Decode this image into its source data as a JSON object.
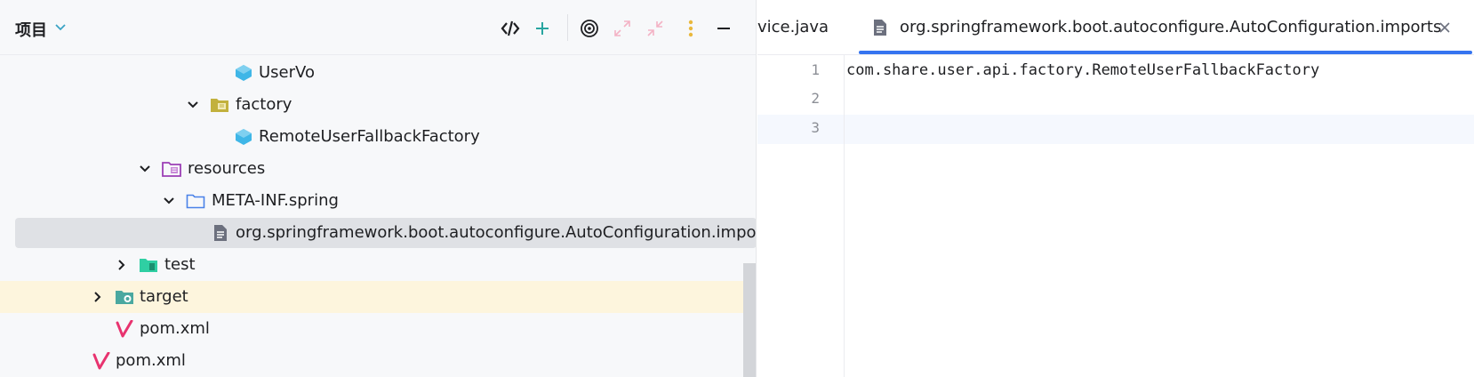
{
  "project_panel": {
    "title": "项目",
    "toolbar": {
      "navigate_icon": "code-link-icon",
      "add_icon": "plus-icon",
      "locate_icon": "target-icon",
      "expand_icon": "expand-all-icon",
      "collapse_icon": "collapse-all-icon",
      "options_icon": "kebab-menu-icon",
      "hide_icon": "minus-icon"
    },
    "tree": [
      {
        "label": "UserVo",
        "icon": "class-icon",
        "arrow": "none"
      },
      {
        "label": "factory",
        "icon": "package-folder-icon",
        "arrow": "expanded"
      },
      {
        "label": "RemoteUserFallbackFactory",
        "icon": "class-icon",
        "arrow": "none"
      },
      {
        "label": "resources",
        "icon": "resources-folder-icon",
        "arrow": "expanded"
      },
      {
        "label": "META-INF.spring",
        "icon": "folder-icon",
        "arrow": "expanded"
      },
      {
        "label": "org.springframework.boot.autoconfigure.AutoConfiguration.imports",
        "icon": "text-file-icon",
        "arrow": "none",
        "selected": true
      },
      {
        "label": "test",
        "icon": "test-folder-icon",
        "arrow": "collapsed"
      },
      {
        "label": "target",
        "icon": "excluded-folder-icon",
        "arrow": "collapsed",
        "highlighted": true
      },
      {
        "label": "pom.xml",
        "icon": "maven-icon",
        "arrow": "none"
      },
      {
        "label": "pom.xml",
        "icon": "maven-icon",
        "arrow": "none"
      }
    ]
  },
  "editor": {
    "tabs": {
      "partial_label": "vice.java",
      "active_label": "org.springframework.boot.autoconfigure.AutoConfiguration.imports",
      "active_icon": "text-file-icon",
      "close_icon": "close-icon"
    },
    "line_numbers": [
      "1",
      "2",
      "3"
    ],
    "lines": [
      "com.share.user.api.factory.RemoteUserFallbackFactory",
      "",
      ""
    ]
  },
  "colors": {
    "accent": "#3574f0",
    "selection": "#dfe1e5",
    "highlight_row": "#fdf5dd",
    "class_icon": "#3fb6e7",
    "maven_icon": "#e8336f"
  }
}
